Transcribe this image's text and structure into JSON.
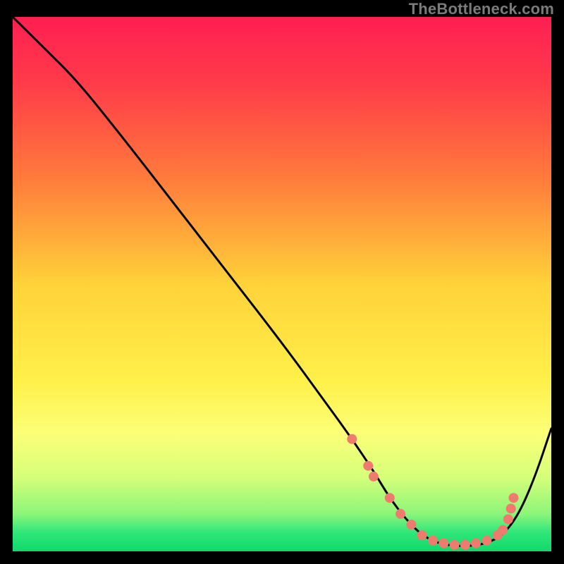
{
  "watermark": "TheBottleneck.com",
  "colors": {
    "page_bg": "#000000",
    "curve": "#000000",
    "marker_fill": "#ef7b6f",
    "marker_stroke": "#ef7b6f",
    "gradient_stops": [
      {
        "offset": 0.0,
        "color": "#ff1f52"
      },
      {
        "offset": 0.12,
        "color": "#ff3a4a"
      },
      {
        "offset": 0.3,
        "color": "#ff7a3c"
      },
      {
        "offset": 0.5,
        "color": "#ffd23a"
      },
      {
        "offset": 0.68,
        "color": "#fff04a"
      },
      {
        "offset": 0.78,
        "color": "#fcff78"
      },
      {
        "offset": 0.86,
        "color": "#d7ff7a"
      },
      {
        "offset": 0.93,
        "color": "#8cf57a"
      },
      {
        "offset": 0.965,
        "color": "#2fe67a"
      },
      {
        "offset": 1.0,
        "color": "#11d86a"
      }
    ]
  },
  "chart_data": {
    "type": "line",
    "title": "",
    "xlabel": "",
    "ylabel": "",
    "xlim": [
      0,
      100
    ],
    "ylim": [
      0,
      100
    ],
    "grid": false,
    "legend": false,
    "series": [
      {
        "name": "curve",
        "x": [
          0,
          6,
          12,
          20,
          30,
          40,
          50,
          58,
          63,
          67,
          70,
          73,
          76,
          79,
          82,
          85,
          88,
          91,
          94,
          97,
          100
        ],
        "y": [
          100,
          94,
          88,
          78,
          65,
          52,
          39,
          28,
          21,
          15,
          10,
          6,
          3,
          1.5,
          1,
          1,
          1.5,
          3,
          7,
          14,
          23
        ]
      }
    ],
    "markers": {
      "series": "curve",
      "points": [
        {
          "x": 63,
          "y": 21
        },
        {
          "x": 66,
          "y": 16
        },
        {
          "x": 67,
          "y": 14
        },
        {
          "x": 70,
          "y": 10
        },
        {
          "x": 72,
          "y": 7
        },
        {
          "x": 74,
          "y": 5
        },
        {
          "x": 76,
          "y": 3
        },
        {
          "x": 78,
          "y": 2
        },
        {
          "x": 80,
          "y": 1.5
        },
        {
          "x": 82,
          "y": 1.2
        },
        {
          "x": 84,
          "y": 1.2
        },
        {
          "x": 86,
          "y": 1.5
        },
        {
          "x": 88,
          "y": 2
        },
        {
          "x": 90,
          "y": 3
        },
        {
          "x": 91,
          "y": 4
        },
        {
          "x": 92,
          "y": 6
        },
        {
          "x": 92.5,
          "y": 8
        },
        {
          "x": 93,
          "y": 10
        }
      ]
    }
  }
}
